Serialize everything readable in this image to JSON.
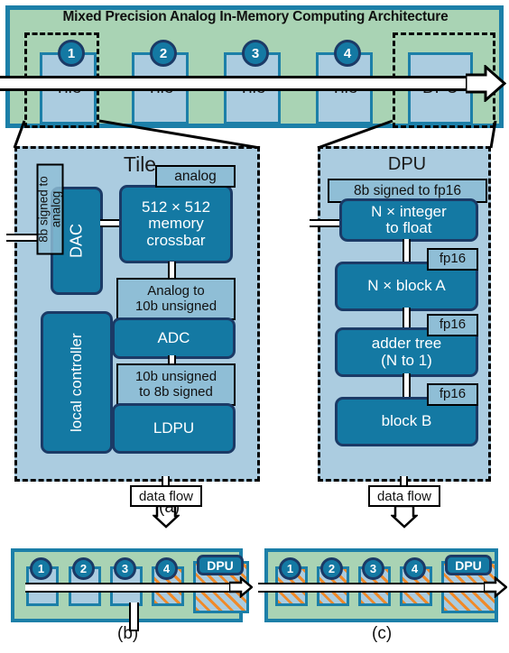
{
  "architecture": {
    "title": "Mixed Precision Analog In-Memory Computing Architecture",
    "tiles": [
      {
        "num": "1",
        "label": "Tile"
      },
      {
        "num": "2",
        "label": "Tile"
      },
      {
        "num": "3",
        "label": "Tile"
      },
      {
        "num": "4",
        "label": "Tile"
      }
    ],
    "dpu_label": "DPU"
  },
  "tile_detail": {
    "title": "Tile",
    "dac": "DAC",
    "dac_note": "8b signed to analog",
    "local_controller": "local controller",
    "crossbar_l1": "512 × 512",
    "crossbar_l2": "memory",
    "crossbar_l3": "crossbar",
    "analog_note": "analog",
    "adc_note_l1": "Analog to",
    "adc_note_l2": "10b unsigned",
    "adc": "ADC",
    "ldpu_note_l1": "10b unsigned",
    "ldpu_note_l2": "to 8b signed",
    "ldpu": "LDPU",
    "data_flow": "data flow"
  },
  "dpu_detail": {
    "title": "DPU",
    "input_note": "8b signed to fp16",
    "int_to_float_l1": "N × integer",
    "int_to_float_l2": "to float",
    "block_a": "N × block A",
    "adder_tree_l1": "adder tree",
    "adder_tree_l2": "(N to 1)",
    "block_b": "block B",
    "fp16": "fp16",
    "data_flow": "data flow"
  },
  "panel_labels": {
    "a": "(a)",
    "b": "(b)",
    "c": "(c)"
  },
  "panel_b": {
    "tiles": [
      {
        "num": "1",
        "hatched": false
      },
      {
        "num": "2",
        "hatched": false
      },
      {
        "num": "3",
        "hatched": false
      },
      {
        "num": "4",
        "hatched": true
      }
    ],
    "dpu_label": "DPU",
    "dpu_hatched": true
  },
  "panel_c": {
    "tiles": [
      {
        "num": "1",
        "hatched": true
      },
      {
        "num": "2",
        "hatched": true
      },
      {
        "num": "3",
        "hatched": true
      },
      {
        "num": "4",
        "hatched": true
      }
    ],
    "dpu_label": "DPU",
    "dpu_hatched": true
  },
  "colors": {
    "band_green": "#a9d3b4",
    "teal_border": "#1c7fa8",
    "light_blue": "#abcce0",
    "dark_blue": "#1479a3",
    "navy": "#1b3a66",
    "hatch_orange": "#f08a2a"
  }
}
